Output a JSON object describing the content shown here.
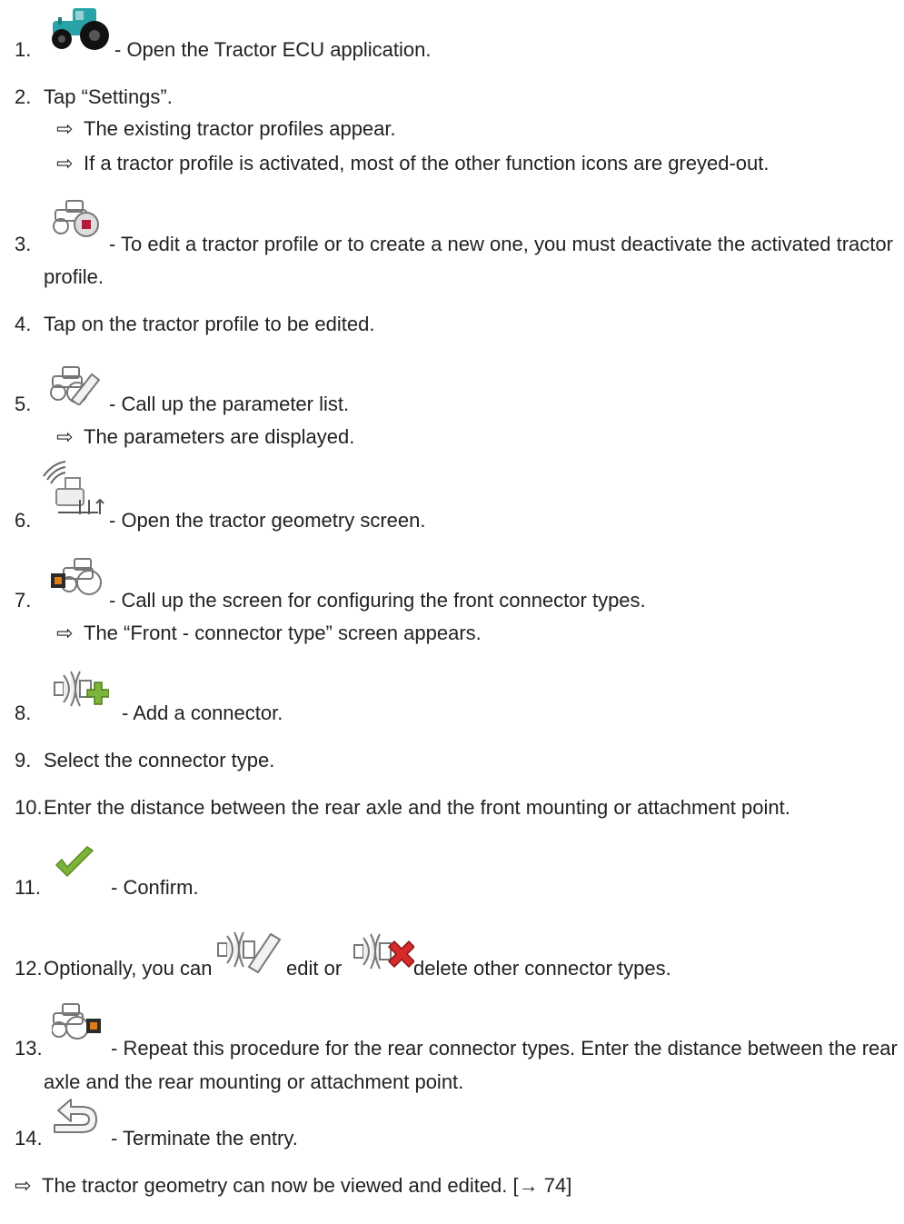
{
  "steps": [
    {
      "num": "1.",
      "icon": "tractor-teal-icon",
      "text": "- Open the Tractor ECU application."
    },
    {
      "num": "2.",
      "text_pre": "Tap ",
      "text_quote": "“Settings”",
      "text_post": ".",
      "results": [
        "The existing tractor profiles appear.",
        "If a tractor profile is activated, most of the other function icons are greyed-out."
      ]
    },
    {
      "num": "3.",
      "icon": "tractor-deactivate-icon",
      "text": "- To edit a tractor profile or to create a new one, you must deactivate the activated tractor",
      "text_cont": "profile."
    },
    {
      "num": "4.",
      "text": "Tap on the tractor profile to be edited."
    },
    {
      "num": "5.",
      "icon": "tractor-edit-icon",
      "text": "- Call up the parameter list.",
      "results": [
        "The parameters are displayed."
      ]
    },
    {
      "num": "6.",
      "icon": "tractor-geometry-icon",
      "text": "- Open the tractor geometry screen."
    },
    {
      "num": "7.",
      "icon": "tractor-front-connector-icon",
      "text": "- Call up the screen for configuring the front connector types.",
      "results": [
        "The “Front - connector type” screen appears."
      ]
    },
    {
      "num": "8.",
      "icon": "connector-add-icon",
      "text": "- Add a connector."
    },
    {
      "num": "9.",
      "text": "Select the connector type."
    },
    {
      "num": "10.",
      "text": "Enter the distance between the rear axle and the front mounting or attachment point."
    },
    {
      "num": "11.",
      "icon": "checkmark-icon",
      "text": "- Confirm."
    },
    {
      "num": "12.",
      "text_pre": "Optionally, you can",
      "icon_a": "connector-edit-icon",
      "text_mid": "edit or",
      "icon_b": "connector-delete-icon",
      "text_post": "delete other connector types."
    },
    {
      "num": "13.",
      "icon": "tractor-rear-connector-icon",
      "text": "- Repeat this procedure for the rear connector types. Enter the distance between the rear",
      "text_cont": "axle and the rear mounting or attachment point."
    },
    {
      "num": "14.",
      "icon": "back-arrow-icon",
      "text": "- Terminate the entry."
    }
  ],
  "final_result": {
    "text": "The tractor geometry can now be viewed and edited. [",
    "ref_arrow": "→",
    "ref_page": " 74]"
  },
  "result_arrow": "⇨",
  "colors": {
    "teal": "#2aa3a8",
    "green": "#7cb33a",
    "red": "#d42b2b",
    "orange": "#e07b1a",
    "grey": "#8a8a8a"
  }
}
